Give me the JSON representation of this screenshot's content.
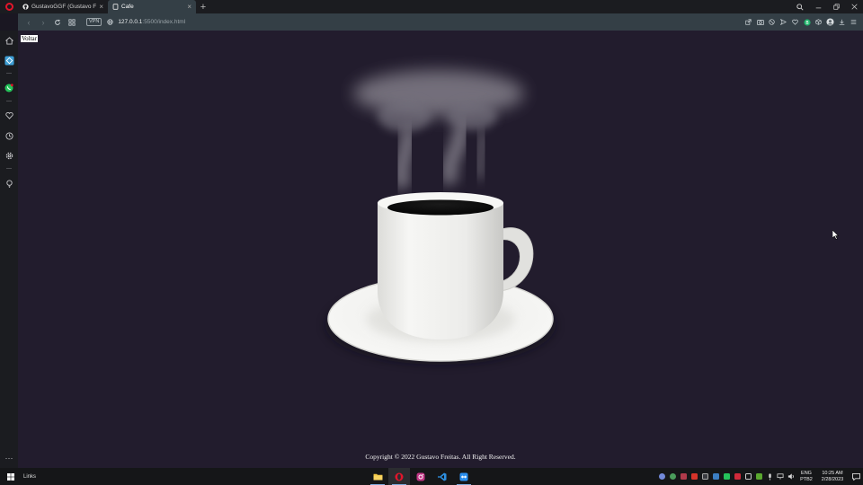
{
  "browser": {
    "tabs": [
      {
        "title": "GustavoGGF (Gustavo Freit",
        "icon": "github-icon",
        "active": false
      },
      {
        "title": "Cafe",
        "icon": "page-icon",
        "active": true
      }
    ],
    "new_tab_label": "+",
    "address": {
      "host": "127.0.0.1",
      "path": ":5500/index.html",
      "vpn_label": "VPN"
    }
  },
  "page": {
    "back_link": "Voltar",
    "footer": "Copyright © 2022 Gustavo Freitas. All Right Reserved."
  },
  "sidebar": {
    "items": [
      "home-icon",
      "workspaces-icon",
      "whatsapp-icon",
      "heart-icon",
      "history-icon",
      "settings-icon",
      "lightbulb-icon",
      "more-icon"
    ]
  },
  "taskbar": {
    "toolbar_label": "Links",
    "pinned": [
      "file-explorer-icon",
      "opera-icon",
      "instagram-icon",
      "vscode-icon",
      "teamviewer-icon"
    ],
    "lang_line1": "ENG",
    "lang_line2": "PTB2",
    "time": "10:25 AM",
    "date": "2/28/2023"
  },
  "colors": {
    "page_bg": "#221c2d",
    "chrome": "#343f46",
    "opera_red": "#e3152b",
    "cup_white": "#f1f1ef",
    "coffee": "#0c0c0c"
  }
}
